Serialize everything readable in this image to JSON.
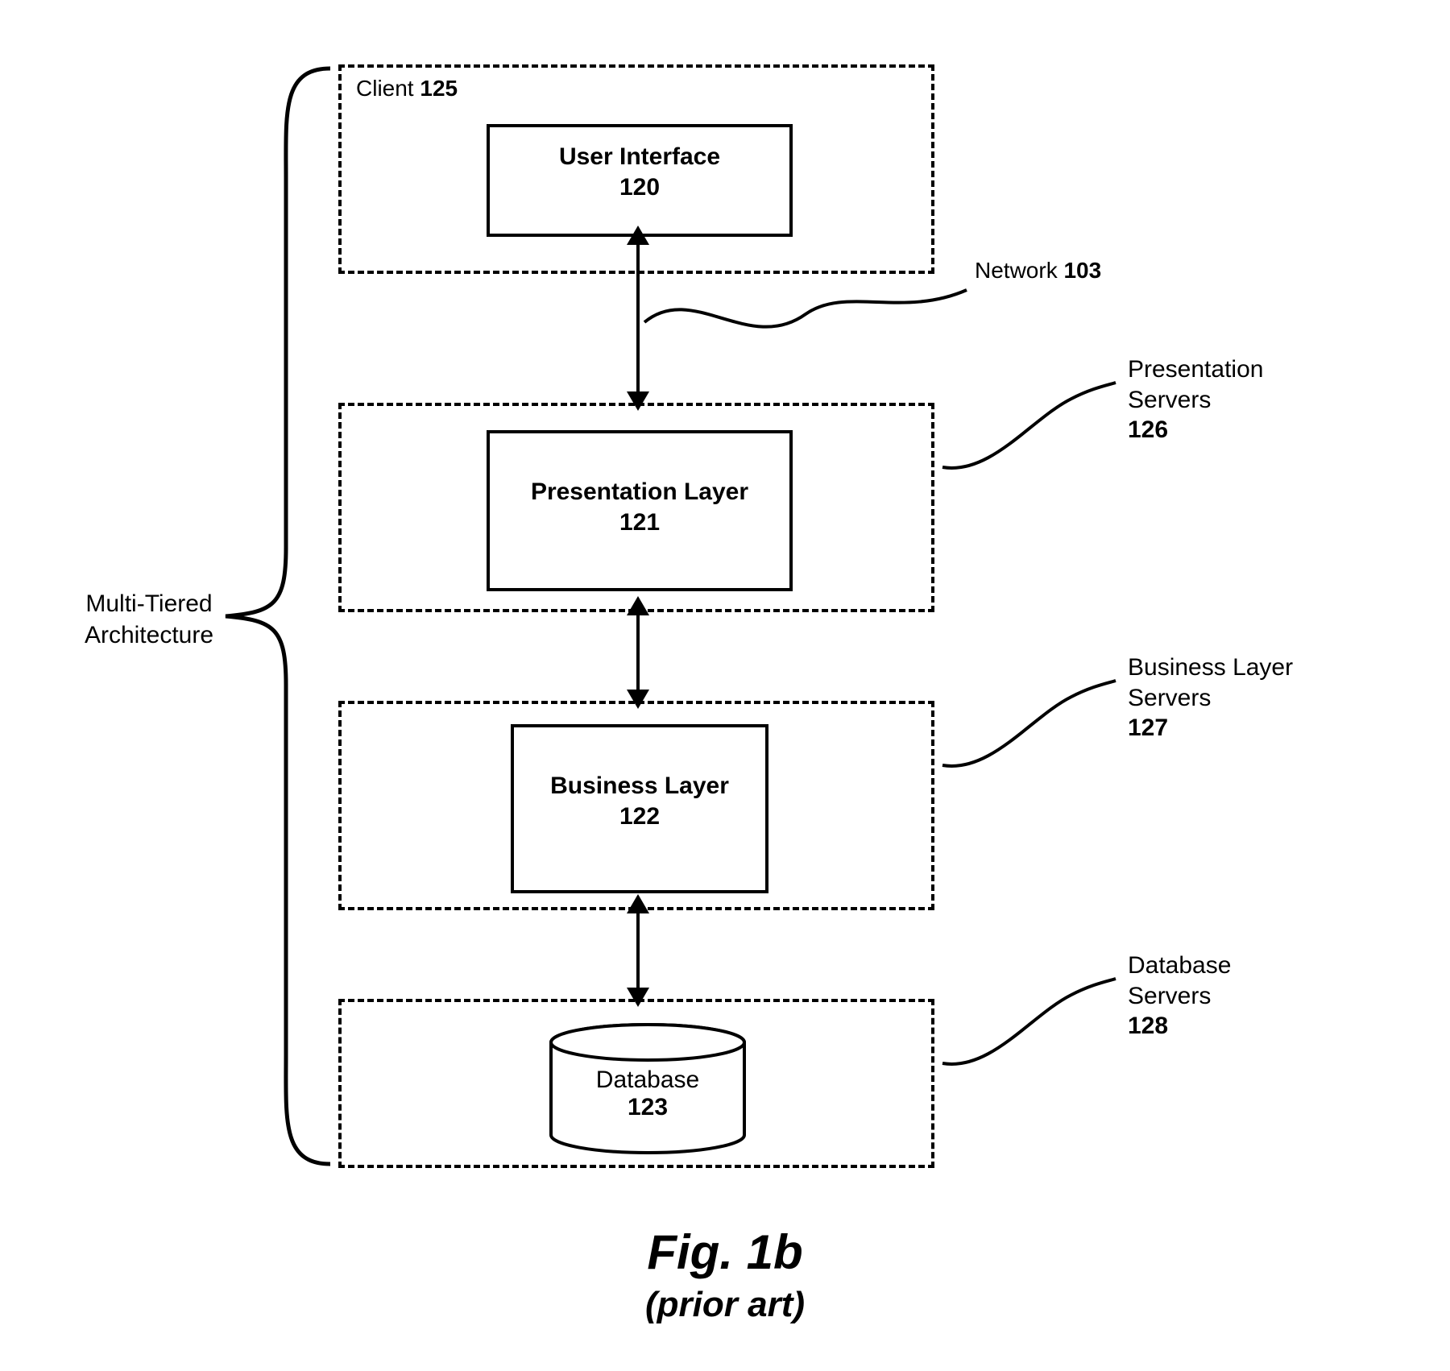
{
  "client": {
    "label": "Client",
    "num": "125"
  },
  "tiers": {
    "ui": {
      "name": "User Interface",
      "num": "120"
    },
    "presentation": {
      "name": "Presentation Layer",
      "num": "121"
    },
    "business": {
      "name": "Business Layer",
      "num": "122"
    },
    "database": {
      "name": "Database",
      "num": "123"
    }
  },
  "network": {
    "label": "Network",
    "num": "103"
  },
  "right": {
    "presentation": {
      "line1": "Presentation",
      "line2": "Servers",
      "num": "126"
    },
    "business": {
      "line1": "Business Layer",
      "line2": "Servers",
      "num": "127"
    },
    "database": {
      "line1": "Database",
      "line2": "Servers",
      "num": "128"
    }
  },
  "left": {
    "line1": "Multi-Tiered",
    "line2": "Architecture"
  },
  "figure": {
    "title": "Fig. 1b",
    "sub": "(prior art)"
  }
}
